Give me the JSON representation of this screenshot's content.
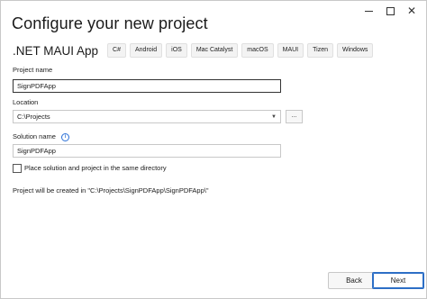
{
  "window": {
    "title": "Configure your new project",
    "controls": {
      "minimize": "minimize",
      "maximize": "maximize",
      "close": "✕"
    }
  },
  "template": {
    "name": ".NET MAUI App",
    "tags": [
      "C#",
      "Android",
      "iOS",
      "Mac Catalyst",
      "macOS",
      "MAUI",
      "Tizen",
      "Windows"
    ]
  },
  "form": {
    "project_name_label": "Project name",
    "project_name_value": "SignPDFApp",
    "location_label": "Location",
    "location_value": "C:\\Projects",
    "browse_label": "...",
    "solution_name_label": "Solution name",
    "solution_name_value": "SignPDFApp",
    "same_dir_label": "Place solution and project in the same directory",
    "same_dir_checked": false,
    "created_path_text": "Project will be created in \"C:\\Projects\\SignPDFApp\\SignPDFApp\\\""
  },
  "footer": {
    "back_label": "Back",
    "next_label": "Next"
  },
  "colors": {
    "accent": "#2d6fc6",
    "border": "#c8c8c8",
    "text": "#1b1b1b"
  },
  "icons": {
    "info": "info-icon",
    "dropdown": "chevron-down-icon"
  }
}
